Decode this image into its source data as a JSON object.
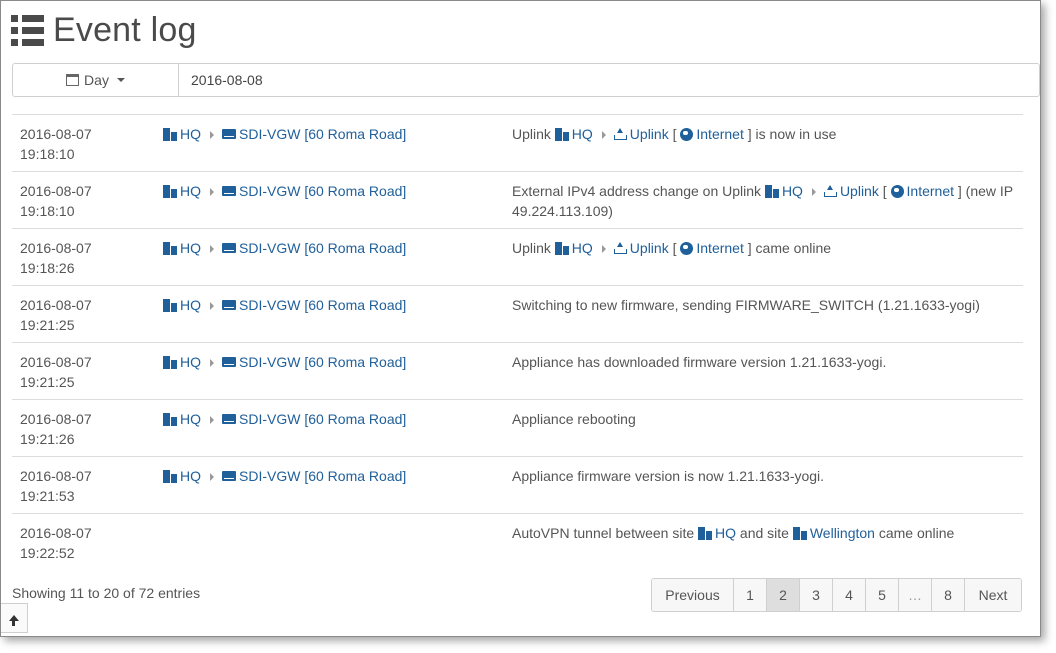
{
  "page": {
    "title": "Event log",
    "title_icon": "list-icon"
  },
  "filter": {
    "period_label": "Day",
    "date_value": "2016-08-08"
  },
  "events": [
    {
      "date": "2016-08-07",
      "time": "19:18:10",
      "site": "HQ",
      "device": "SDI-VGW [60 Roma Road]",
      "parts": [
        {
          "t": "text",
          "v": "Uplink "
        },
        {
          "t": "site",
          "v": "HQ"
        },
        {
          "t": "sep"
        },
        {
          "t": "uplink",
          "v": "Uplink"
        },
        {
          "t": "text",
          "v": " [ "
        },
        {
          "t": "globe",
          "v": "Internet"
        },
        {
          "t": "text",
          "v": " ] is now in use"
        }
      ]
    },
    {
      "date": "2016-08-07",
      "time": "19:18:10",
      "site": "HQ",
      "device": "SDI-VGW [60 Roma Road]",
      "parts": [
        {
          "t": "text",
          "v": "External IPv4 address change on Uplink "
        },
        {
          "t": "site",
          "v": "HQ"
        },
        {
          "t": "sep"
        },
        {
          "t": "uplink",
          "v": "Uplink"
        },
        {
          "t": "text",
          "v": " [ "
        },
        {
          "t": "globe",
          "v": "Internet"
        },
        {
          "t": "text",
          "v": " ] (new IP 49.224.113.109)"
        }
      ]
    },
    {
      "date": "2016-08-07",
      "time": "19:18:26",
      "site": "HQ",
      "device": "SDI-VGW [60 Roma Road]",
      "parts": [
        {
          "t": "text",
          "v": "Uplink "
        },
        {
          "t": "site",
          "v": "HQ"
        },
        {
          "t": "sep"
        },
        {
          "t": "uplink",
          "v": "Uplink"
        },
        {
          "t": "text",
          "v": " [ "
        },
        {
          "t": "globe",
          "v": "Internet"
        },
        {
          "t": "text",
          "v": " ] came online"
        }
      ]
    },
    {
      "date": "2016-08-07",
      "time": "19:21:25",
      "site": "HQ",
      "device": "SDI-VGW [60 Roma Road]",
      "parts": [
        {
          "t": "text",
          "v": "Switching to new firmware, sending FIRMWARE_SWITCH (1.21.1633-yogi)"
        }
      ]
    },
    {
      "date": "2016-08-07",
      "time": "19:21:25",
      "site": "HQ",
      "device": "SDI-VGW [60 Roma Road]",
      "parts": [
        {
          "t": "text",
          "v": "Appliance has downloaded firmware version 1.21.1633-yogi."
        }
      ]
    },
    {
      "date": "2016-08-07",
      "time": "19:21:26",
      "site": "HQ",
      "device": "SDI-VGW [60 Roma Road]",
      "parts": [
        {
          "t": "text",
          "v": "Appliance rebooting"
        }
      ]
    },
    {
      "date": "2016-08-07",
      "time": "19:21:53",
      "site": "HQ",
      "device": "SDI-VGW [60 Roma Road]",
      "parts": [
        {
          "t": "text",
          "v": "Appliance firmware version is now 1.21.1633-yogi."
        }
      ]
    },
    {
      "date": "2016-08-07",
      "time": "19:22:52",
      "site": "",
      "device": "",
      "parts": [
        {
          "t": "text",
          "v": "AutoVPN tunnel between site "
        },
        {
          "t": "site",
          "v": "HQ"
        },
        {
          "t": "text",
          "v": " and site "
        },
        {
          "t": "site",
          "v": "Wellington"
        },
        {
          "t": "text",
          "v": " came online"
        }
      ]
    }
  ],
  "footer": {
    "info": "Showing 11 to 20 of 72 entries",
    "pages": [
      "Previous",
      "1",
      "2",
      "3",
      "4",
      "5",
      "…",
      "8",
      "Next"
    ],
    "active_page": "2"
  },
  "colors": {
    "link": "#1f5f9a",
    "text": "#4a4a4a"
  }
}
